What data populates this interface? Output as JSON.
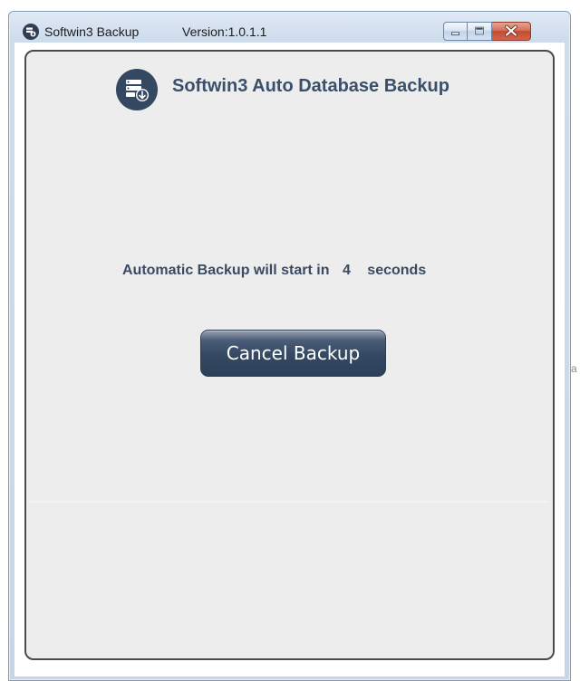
{
  "window": {
    "title": "Softwin3 Backup",
    "version": "Version:1.0.1.1"
  },
  "caption_buttons": {
    "minimize_icon": "minimize-icon",
    "maximize_icon": "maximize-icon",
    "close_icon": "close-icon"
  },
  "app": {
    "heading": "Softwin3 Auto Database Backup",
    "logo_icon": "database-download-icon"
  },
  "countdown": {
    "prefix": "Automatic Backup will start in",
    "seconds": "4",
    "suffix": "seconds"
  },
  "actions": {
    "cancel_label": "Cancel Backup"
  },
  "background": {
    "fragment": "a"
  },
  "colors": {
    "accent": "#344862",
    "heading_text": "#3b4f6b",
    "panel_bg": "#ededed",
    "close_button": "#c24a31"
  }
}
